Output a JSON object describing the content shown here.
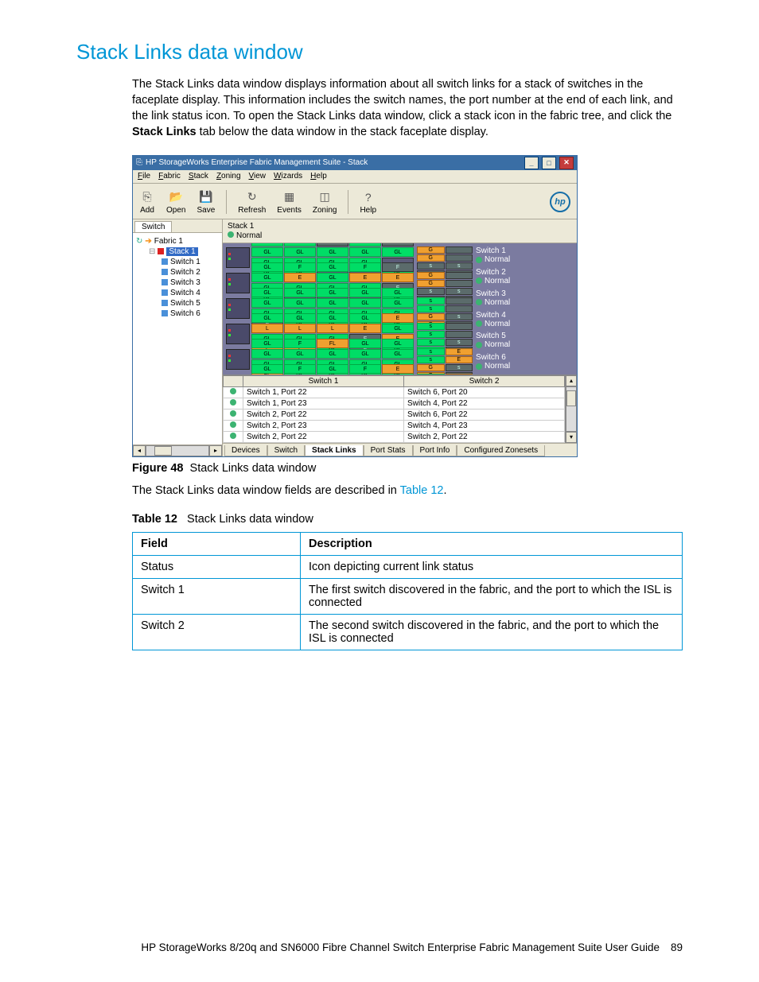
{
  "section_title": "Stack Links data window",
  "intro": {
    "p1_a": "The Stack Links data window displays information about all switch links for a stack of switches in the faceplate display. This information includes the switch names, the port number at the end of each link, and the link status icon. To open the Stack Links data window, click a stack icon in the fabric tree, and click the ",
    "p1_b": "Stack Links",
    "p1_c": " tab below the data window in the stack faceplate display."
  },
  "figure": {
    "label": "Figure 48",
    "caption": "Stack Links data window"
  },
  "after_fig_a": "The Stack Links data window fields are described in ",
  "after_fig_link": "Table 12",
  "after_fig_b": ".",
  "table_caption": {
    "label": "Table 12",
    "caption": "Stack Links data window"
  },
  "field_table": {
    "headers": [
      "Field",
      "Description"
    ],
    "rows": [
      [
        "Status",
        "Icon depicting current link status"
      ],
      [
        "Switch 1",
        "The first switch discovered in the fabric, and the port to which the ISL is connected"
      ],
      [
        "Switch 2",
        "The second switch discovered in the fabric, and the port to which the ISL is connected"
      ]
    ]
  },
  "footer": {
    "text": "HP StorageWorks 8/20q and SN6000 Fibre Channel Switch Enterprise Fabric Management Suite User Guide",
    "page": "89"
  },
  "ss": {
    "title": "HP StorageWorks Enterprise Fabric Management Suite - Stack",
    "menu": [
      "File",
      "Fabric",
      "Stack",
      "Zoning",
      "View",
      "Wizards",
      "Help"
    ],
    "toolbar": [
      {
        "icon": "⎘",
        "label": "Add"
      },
      {
        "icon": "📂",
        "label": "Open"
      },
      {
        "icon": "💾",
        "label": "Save"
      },
      {
        "sep": true
      },
      {
        "icon": "↻",
        "label": "Refresh"
      },
      {
        "icon": "▦",
        "label": "Events"
      },
      {
        "icon": "◫",
        "label": "Zoning"
      },
      {
        "sep": true
      },
      {
        "icon": "?",
        "label": "Help"
      }
    ],
    "hp": "hp",
    "left_tab": "Switch",
    "tree": {
      "root": "Fabric 1",
      "stack": "Stack 1",
      "children": [
        "Switch 1",
        "Switch 2",
        "Switch 3",
        "Switch 4",
        "Switch 5",
        "Switch 6"
      ]
    },
    "stack_header": {
      "name": "Stack 1",
      "status": "Normal"
    },
    "switch_rows": [
      {
        "ports": [
          [
            "GL",
            "F",
            "F",
            "GL",
            "F",
            "GL",
            "GL",
            "GL",
            "GL",
            "GL"
          ],
          [
            "GL",
            "GL",
            "GL",
            "GL",
            "",
            "GL",
            "GL",
            "",
            "",
            "GL"
          ]
        ],
        "cls": [
          [
            "g",
            "g",
            "sl",
            "g",
            "sl",
            "g",
            "g",
            "g",
            "g",
            "g"
          ],
          [
            "g",
            "g",
            "g",
            "g",
            "b",
            "g",
            "g",
            "b",
            "b",
            "g"
          ]
        ],
        "x": [
          [
            "G",
            "",
            "G",
            ""
          ],
          [
            "s",
            "s",
            "s",
            "s"
          ]
        ],
        "xc": [
          [
            "a",
            "b",
            "a",
            "b"
          ],
          [
            "sl",
            "sl",
            "sl",
            "sl"
          ]
        ]
      },
      {
        "ports": [
          [
            "GL",
            "F",
            "GL",
            "F",
            "F",
            "GL",
            "E",
            "GL",
            "E",
            "E"
          ],
          [
            "GL",
            "GL",
            "GL",
            "GL",
            "F",
            "GL",
            "",
            "",
            "",
            "GL"
          ]
        ],
        "cls": [
          [
            "g",
            "g",
            "g",
            "g",
            "sl",
            "g",
            "a",
            "g",
            "a",
            "a"
          ],
          [
            "g",
            "g",
            "g",
            "g",
            "sl",
            "g",
            "b",
            "b",
            "b",
            "g"
          ]
        ],
        "x": [
          [
            "G",
            "",
            "G",
            ""
          ],
          [
            "s",
            "s",
            "s",
            "s"
          ]
        ],
        "xc": [
          [
            "a",
            "b",
            "a",
            "b"
          ],
          [
            "sl",
            "sl",
            "sl",
            "sl"
          ]
        ]
      },
      {
        "ports": [
          [
            "GL",
            "GL",
            "GL",
            "GL",
            "GL",
            "GL",
            "GL",
            "GL",
            "GL",
            "GL"
          ],
          [
            "GL",
            "GL",
            "GL",
            "GL",
            "GL",
            "F",
            "GL",
            "GL",
            "GL",
            "GL"
          ]
        ],
        "cls": [
          [
            "g",
            "g",
            "g",
            "g",
            "g",
            "g",
            "g",
            "g",
            "g",
            "g"
          ],
          [
            "g",
            "g",
            "g",
            "g",
            "g",
            "sl",
            "g",
            "g",
            "g",
            "g"
          ]
        ],
        "x": [
          [
            "s",
            "",
            "s",
            ""
          ],
          [
            "G",
            "s",
            "G",
            "s"
          ]
        ],
        "xc": [
          [
            "g",
            "b",
            "g",
            "b"
          ],
          [
            "a",
            "sl",
            "a",
            "sl"
          ]
        ]
      },
      {
        "ports": [
          [
            "GL",
            "GL",
            "GL",
            "GL",
            "E",
            "L",
            "L",
            "L",
            "E",
            "GL"
          ],
          [
            "GL",
            "GL",
            "GL",
            "F",
            "E",
            "L",
            "L",
            "GL",
            "F",
            "GL"
          ]
        ],
        "cls": [
          [
            "g",
            "g",
            "g",
            "g",
            "a",
            "a",
            "a",
            "a",
            "a",
            "g"
          ],
          [
            "g",
            "g",
            "g",
            "sl",
            "a",
            "a",
            "a",
            "g",
            "sl",
            "g"
          ]
        ],
        "x": [
          [
            "s",
            "",
            "s",
            ""
          ],
          [
            "s",
            "s",
            "s",
            "s"
          ]
        ],
        "xc": [
          [
            "g",
            "b",
            "g",
            "b"
          ],
          [
            "g",
            "sl",
            "g",
            "sl"
          ]
        ]
      },
      {
        "ports": [
          [
            "GL",
            "F",
            "FL",
            "GL",
            "GL",
            "GL",
            "GL",
            "GL",
            "GL",
            "GL"
          ],
          [
            "GL",
            "GL",
            "GL",
            "GL",
            "GL",
            "FL",
            "GL",
            "GL",
            "GL",
            "GL"
          ]
        ],
        "cls": [
          [
            "g",
            "g",
            "a",
            "g",
            "g",
            "g",
            "g",
            "g",
            "g",
            "g"
          ],
          [
            "g",
            "g",
            "g",
            "g",
            "g",
            "a",
            "g",
            "g",
            "g",
            "g"
          ]
        ],
        "x": [
          [
            "s",
            "E",
            "s",
            "E"
          ],
          [
            "G",
            "s",
            "G",
            "s"
          ]
        ],
        "xc": [
          [
            "g",
            "a",
            "g",
            "a"
          ],
          [
            "a",
            "sl",
            "a",
            "sl"
          ]
        ]
      },
      {
        "ports": [
          [
            "GL",
            "F",
            "GL",
            "F",
            "E",
            "L",
            "E",
            "E",
            "GL",
            "E"
          ],
          [
            "GL",
            "GL",
            "GL",
            "F",
            "E",
            "L",
            "E",
            "E",
            "E",
            "E"
          ]
        ],
        "cls": [
          [
            "g",
            "g",
            "g",
            "g",
            "a",
            "a",
            "a",
            "a",
            "g",
            "a"
          ],
          [
            "g",
            "g",
            "g",
            "sl",
            "a",
            "a",
            "a",
            "a",
            "a",
            "a"
          ]
        ],
        "x": [
          [
            "s",
            "E",
            "s",
            "E"
          ],
          [
            "s",
            "s",
            "s",
            "s"
          ]
        ],
        "xc": [
          [
            "g",
            "a",
            "g",
            "a"
          ],
          [
            "g",
            "a",
            "g",
            "a"
          ]
        ]
      }
    ],
    "status_list": [
      {
        "name": "Switch 1",
        "status": "Normal"
      },
      {
        "name": "Switch 2",
        "status": "Normal"
      },
      {
        "name": "Switch 3",
        "status": "Normal"
      },
      {
        "name": "Switch 4",
        "status": "Normal"
      },
      {
        "name": "Switch 5",
        "status": "Normal"
      },
      {
        "name": "Switch 6",
        "status": "Normal"
      }
    ],
    "links": {
      "headers": [
        "",
        "Switch 1",
        "Switch 2"
      ],
      "rows": [
        [
          "Switch 1, Port 22",
          "Switch 6, Port 20"
        ],
        [
          "Switch 1, Port 23",
          "Switch 4, Port 22"
        ],
        [
          "Switch 2, Port 22",
          "Switch 6, Port 22"
        ],
        [
          "Switch 2, Port 23",
          "Switch 4, Port 23"
        ],
        [
          "Switch 2, Port 22",
          "Switch 2, Port 22"
        ]
      ]
    },
    "bottom_tabs": [
      "Devices",
      "Switch",
      "Stack Links",
      "Port Stats",
      "Port Info",
      "Configured Zonesets"
    ],
    "active_bottom_tab": "Stack Links"
  }
}
